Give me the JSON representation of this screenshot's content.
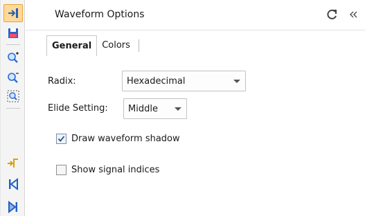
{
  "panel": {
    "title": "Waveform Options"
  },
  "header": {
    "refresh_icon": "refresh-icon",
    "collapse_icon": "double-chevron-left-icon"
  },
  "toolbar": {
    "items": [
      "goto-cursor-icon",
      "save-icon",
      "zoom-in-icon",
      "zoom-out-icon",
      "zoom-fit-icon",
      "swap-cursor-icon",
      "go-to-start-icon",
      "go-to-end-icon"
    ],
    "active_index": 0,
    "accent": "#e8a33a"
  },
  "tabs": [
    {
      "label": "General",
      "selected": true
    },
    {
      "label": "Colors",
      "selected": false
    }
  ],
  "form": {
    "radix": {
      "label": "Radix:",
      "value": "Hexadecimal"
    },
    "elide": {
      "label": "Elide Setting:",
      "value": "Middle"
    },
    "draw_shadow": {
      "label": "Draw waveform shadow",
      "checked": true
    },
    "show_indices": {
      "label": "Show signal indices",
      "checked": false
    }
  }
}
